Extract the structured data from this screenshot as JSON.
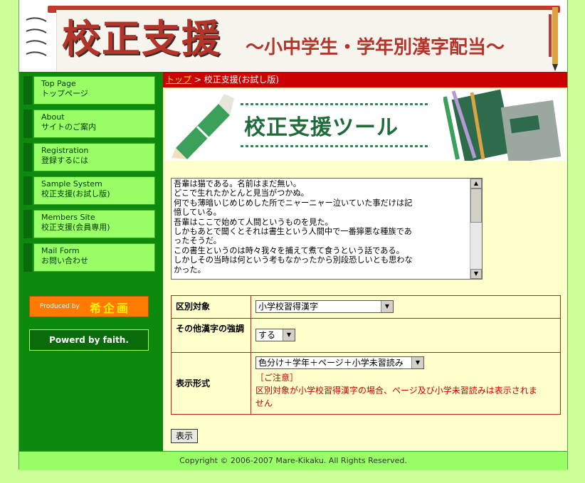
{
  "header": {
    "title": "校正支援",
    "subtitle": "～小中学生・学年別漢字配当～"
  },
  "sidebar": {
    "items": [
      {
        "en": "Top Page",
        "ja": "トップページ"
      },
      {
        "en": "About",
        "ja": "サイトのご案内"
      },
      {
        "en": "Registration",
        "ja": "登録するには"
      },
      {
        "en": "Sample System",
        "ja": "校正支援(お試し版)"
      },
      {
        "en": "Members Site",
        "ja": "校正支援(会員専用)"
      },
      {
        "en": "Mail Form",
        "ja": "お問い合わせ"
      }
    ],
    "produced_label": "Produced by",
    "produced_name": "希企画",
    "powered": "Powerd by faith."
  },
  "breadcrumb": {
    "home": "トップ",
    "separator": " > ",
    "current": "校正支援(お試し版)"
  },
  "banner": {
    "title": "校正支援ツール"
  },
  "textarea": {
    "lines": [
      "吾輩は猫である。名前はまだ無い。",
      "どこで生れたかとんと見当がつかぬ。",
      "何でも薄暗いじめじめした所でニャーニャー泣いていた事だけは記",
      "憶している。",
      "吾輩はここで始めて人間というものを見た。",
      "しかもあとで聞くとそれは書生という人間中で一番獰悪な種族であ",
      "ったそうだ。",
      "この書生というのは時々我々を捕えて煮て食うという話である。",
      "しかしその当時は何という考もなかったから別段恐しいとも思わな",
      "かった。"
    ]
  },
  "options": {
    "target_label": "区別対象",
    "target_value": "小学校習得漢字",
    "emphasis_label": "その他漢字の強調",
    "emphasis_value": "する",
    "format_label": "表示形式",
    "format_value": "色分け＋学年＋ページ＋小学未習読み",
    "note_title": "［ご注意］",
    "note_line1": "区別対象が小学校習得漢字の場合、ページ及び小学未習読みは表示されま",
    "note_line2": "せん"
  },
  "submit_label": "表示",
  "footer": {
    "copyright": "Copyright © 2006-2007 Mare-Kikaku. All Rights Reserved."
  },
  "colors": {
    "accent_red": "#cc0000",
    "sidebar_green": "#0d8a0d",
    "nav_light_green": "#99ff66",
    "background": "#ccff99"
  }
}
